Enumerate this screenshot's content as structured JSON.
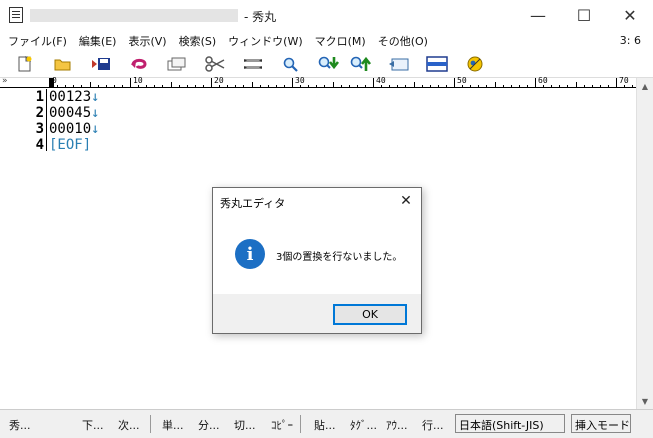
{
  "window": {
    "title_suffix": "- 秀丸",
    "minimize": "—",
    "maximize": "☐",
    "close": "✕"
  },
  "menu": {
    "items": [
      "ファイル(F)",
      "編集(E)",
      "表示(V)",
      "検索(S)",
      "ウィンドウ(W)",
      "マクロ(M)",
      "その他(O)"
    ],
    "caret_position": "3: 6"
  },
  "toolbar": {
    "icons": [
      "new-file-icon",
      "open-folder-icon",
      "save-icon",
      "undo-icon",
      "copy-icon",
      "cut-icon",
      "paste-icon",
      "search-icon",
      "search-down-icon",
      "search-up-icon",
      "replace-icon",
      "split-window-icon",
      "help-icon"
    ]
  },
  "ruler": {
    "labels": [
      "0",
      "10",
      "20",
      "30",
      "40",
      "50",
      "60",
      "70"
    ],
    "arrow": "»"
  },
  "editor": {
    "lines": [
      {
        "num": "1",
        "text": "00123",
        "end": "↓"
      },
      {
        "num": "2",
        "text": "00045",
        "end": "↓"
      },
      {
        "num": "3",
        "text": "00010",
        "end": "↓"
      },
      {
        "num": "4",
        "text": "",
        "end": "[EOF]"
      }
    ]
  },
  "statusbar": {
    "items": [
      "秀...",
      "下...",
      "次...",
      "単...",
      "分...",
      "切...",
      "ｺﾋﾟｰ",
      "貼...",
      "ﾀｸﾞ...",
      "ｱｳ...",
      "行..."
    ],
    "encoding": "日本語(Shift-JIS)",
    "mode": "挿入モード"
  },
  "dialog": {
    "title": "秀丸エディタ",
    "close": "✕",
    "icon": "i",
    "message": "3個の置換を行ないました。",
    "ok_label": "OK"
  }
}
